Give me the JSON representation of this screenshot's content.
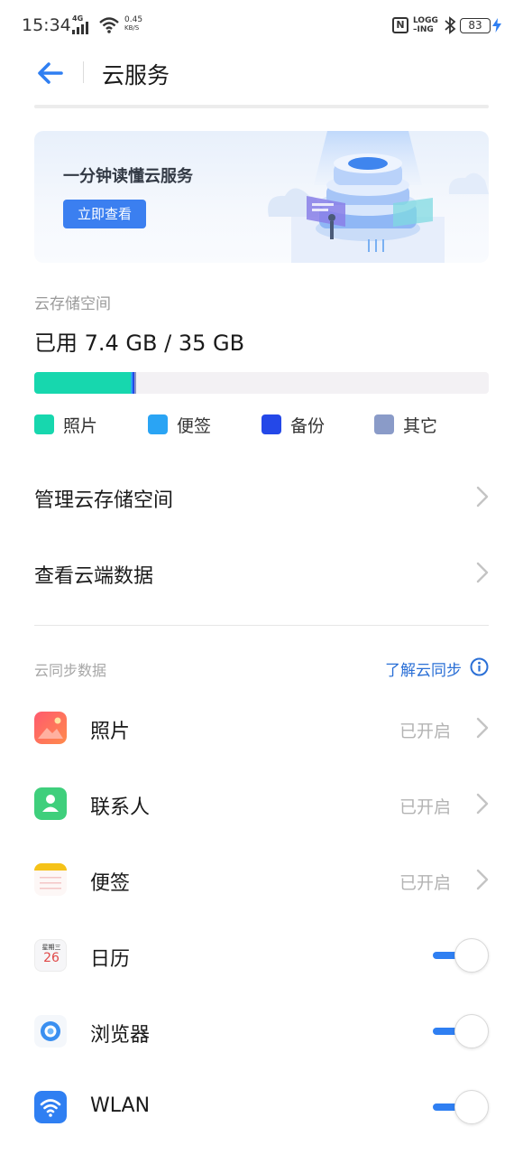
{
  "status_bar": {
    "time": "15:34",
    "network": "4G",
    "speed_value": "0.45",
    "speed_unit": "KB/S",
    "nfc": "N",
    "logging_line1": "LOGG",
    "logging_line2": "–ING",
    "battery": "83"
  },
  "header": {
    "title": "云服务"
  },
  "banner": {
    "text": "一分钟读懂云服务",
    "button_label": "立即查看"
  },
  "storage": {
    "section_label": "云存储空间",
    "used_text": "已用 7.4 GB / 35 GB",
    "used_fraction": 0.21,
    "segments": [
      {
        "name": "照片",
        "fraction": 0.212,
        "color": "#17d7ae"
      },
      {
        "name": "便签",
        "fraction": 0.002,
        "color": "#2aa4f4"
      },
      {
        "name": "备份",
        "fraction": 0.004,
        "color": "#2448e8"
      },
      {
        "name": "其它",
        "fraction": 0.002,
        "color": "#8a96c8"
      }
    ],
    "legend": [
      {
        "label": "照片",
        "color": "#17d7ae"
      },
      {
        "label": "便签",
        "color": "#2aa4f4"
      },
      {
        "label": "备份",
        "color": "#2448e8"
      },
      {
        "label": "其它",
        "color": "#8a9bc8"
      }
    ]
  },
  "menu": {
    "manage_label": "管理云存储空间",
    "view_label": "查看云端数据"
  },
  "sync": {
    "section_label": "云同步数据",
    "learn_link": "了解云同步",
    "items": [
      {
        "label": "照片",
        "status": "已开启",
        "icon": "photos-icon"
      },
      {
        "label": "联系人",
        "status": "已开启",
        "icon": "contacts-icon"
      },
      {
        "label": "便签",
        "status": "已开启",
        "icon": "notes-icon"
      },
      {
        "label": "日历",
        "icon": "calendar-icon",
        "enabled": true,
        "calendar_weekday": "星期三",
        "calendar_day": "26"
      },
      {
        "label": "浏览器",
        "icon": "browser-icon",
        "enabled": true
      },
      {
        "label": "WLAN",
        "icon": "wlan-icon",
        "enabled": true
      }
    ]
  },
  "colors": {
    "accent": "#2f7ff2",
    "link": "#2a6fd6",
    "banner_button": "#3b7ff0"
  }
}
